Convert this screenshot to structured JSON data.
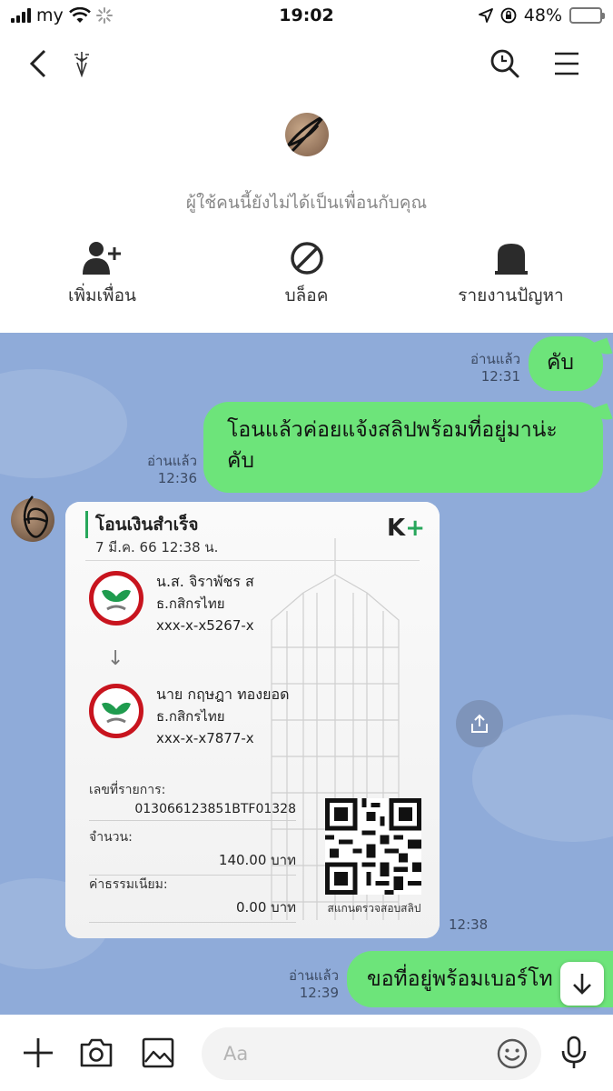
{
  "status_bar": {
    "carrier": "my",
    "time": "19:02",
    "battery_percent": "48%",
    "battery_level": 0.48
  },
  "header": {
    "back_icon": "chevron-left-icon",
    "title_icon": "pen-emblem-icon",
    "search_icon": "search-icon",
    "menu_icon": "hamburger-menu-icon"
  },
  "profile": {
    "notice": "ผู้ใช้คนนี้ยังไม่ได้เป็นเพื่อนกับคุณ",
    "actions": [
      {
        "label": "เพิ่มเพื่อน",
        "icon": "add-friend-icon"
      },
      {
        "label": "บล็อค",
        "icon": "block-icon"
      },
      {
        "label": "รายงานปัญหา",
        "icon": "report-icon"
      }
    ]
  },
  "chat": {
    "messages": [
      {
        "text": "คับ",
        "read": "อ่านแล้ว",
        "time": "12:31"
      },
      {
        "text_line1": "โอนแล้วค่อยแจ้งสลิปพร้อมที่อยู่มาน่ะ",
        "text_line2": "คับ",
        "read": "อ่านแล้ว",
        "time": "12:36"
      },
      {
        "text": "ขอที่อยู่พร้อมเบอร์โท",
        "read": "อ่านแล้ว",
        "time": "12:39"
      }
    ],
    "slip": {
      "title": "โอนเงินสำเร็จ",
      "date": "7 มี.ค. 66  12:38 น.",
      "brand_k": "K",
      "brand_plus": "+",
      "from_name": "น.ส. จิราพัชร ส",
      "from_bank": "ธ.กสิกรไทย",
      "from_account": "xxx-x-x5267-x",
      "to_name": "นาย กฤษฎา ทองยอด",
      "to_bank": "ธ.กสิกรไทย",
      "to_account": "xxx-x-x7877-x",
      "ref_label": "เลขที่รายการ:",
      "ref_value": "013066123851BTF01328",
      "amount_label": "จำนวน:",
      "amount_value": "140.00 บาท",
      "fee_label": "ค่าธรรมเนียม:",
      "fee_value": "0.00 บาท",
      "qr_caption": "สแกนตรวจสอบสลิป",
      "time": "12:38"
    }
  },
  "input_bar": {
    "placeholder": "Aa"
  }
}
